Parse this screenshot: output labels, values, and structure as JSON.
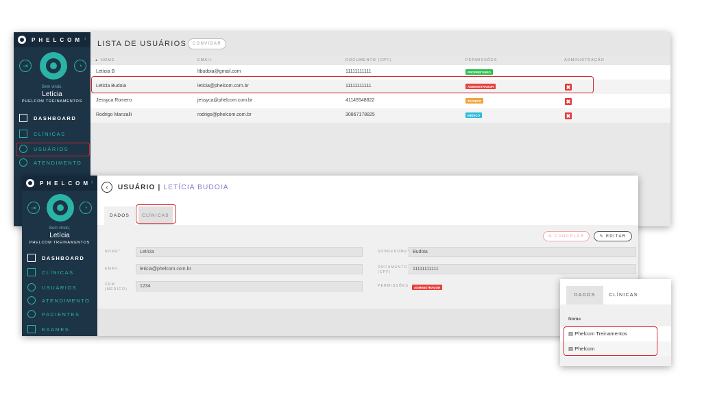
{
  "brand": {
    "name": "PHELCOM"
  },
  "sidebar": {
    "welcome": "Bem vindo,",
    "user_name": "Letícia",
    "org": "PHELCOM TREINAMENTOS",
    "items_top": [
      "DASHBOARD",
      "CLÍNICAS",
      "USUÁRIOS",
      "ATENDIMENTO"
    ],
    "items_bottom": [
      "DASHBOARD",
      "CLÍNICAS",
      "USUÁRIOS",
      "ATENDIMENTO",
      "PACIENTES",
      "EXAMES"
    ]
  },
  "users_list": {
    "title": "LISTA DE USUÁRIOS",
    "invite_label": "CONVIDAR",
    "columns": [
      "NOME",
      "EMAIL",
      "DOCUMENTO (CPF)",
      "PERMISSÕES",
      "ADMINISTRAÇÃO"
    ],
    "rows": [
      {
        "name": "Letícia B",
        "email": "ltbudoia@gmail.com",
        "doc": "11111111111",
        "perm": "PROPRIETARIO",
        "perm_color": "#2ebd4e",
        "admin": false
      },
      {
        "name": "Leticia Budoia",
        "email": "leticia@phelcom.com.br",
        "doc": "11111111111",
        "perm": "ADMINISTRADOR",
        "perm_color": "#e8403c",
        "admin": true
      },
      {
        "name": "Jessyca Romero",
        "email": "jessyca@phelcom.com.br",
        "doc": "41145548822",
        "perm": "TÉCNICO",
        "perm_color": "#f2a23a",
        "admin": true
      },
      {
        "name": "Rodrigo Manzalli",
        "email": "rodrigo@phelcom.com.br",
        "doc": "30867178825",
        "perm": "MÉDICO",
        "perm_color": "#2cbcd8",
        "admin": true
      }
    ],
    "delete_symbol": "✖"
  },
  "user_detail": {
    "title_prefix": "USUÁRIO |",
    "title_name": "LETÍCIA BUDOIA",
    "tabs": [
      "DADOS",
      "CLÍNICAS"
    ],
    "cancel_label": "CANCELAR",
    "edit_label": "EDITAR",
    "fields": {
      "nome_label": "NOME*",
      "nome_value": "Letícia",
      "sobrenome_label": "SOBRENOME*",
      "sobrenome_value": "Budoia",
      "email_label": "EMAIL",
      "email_value": "leticia@phelcom.com.br",
      "documento_label": "DOCUMENTO (CPF)",
      "documento_value": "11111111111",
      "crm_label": "CRM (MÉDICO)",
      "crm_value": "1234",
      "permissoes_label": "PERMISSÕES",
      "permissoes_value": "ADMINISTRADOR"
    }
  },
  "clinics_panel": {
    "tabs": [
      "DADOS",
      "CLÍNICAS"
    ],
    "column": "Nome",
    "items": [
      "Phelcom Treinamentos",
      "Phelcom"
    ]
  },
  "colors": {
    "sidebar": "#1c3446",
    "teal": "#2ab3a6",
    "highlight": "#d6252a",
    "accent_purple": "#7c79c9"
  }
}
